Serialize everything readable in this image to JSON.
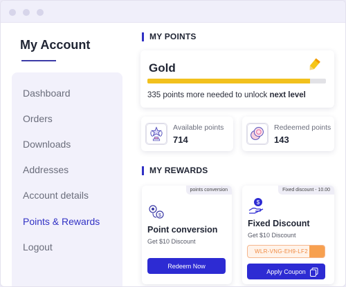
{
  "sidebar": {
    "title": "My Account",
    "items": [
      {
        "label": "Dashboard",
        "active": false
      },
      {
        "label": "Orders",
        "active": false
      },
      {
        "label": "Downloads",
        "active": false
      },
      {
        "label": "Addresses",
        "active": false
      },
      {
        "label": "Account details",
        "active": false
      },
      {
        "label": "Points & Rewards",
        "active": true
      },
      {
        "label": "Logout",
        "active": false
      }
    ]
  },
  "points": {
    "heading": "MY POINTS",
    "level_name": "Gold",
    "progress_fraction": 0.91,
    "note_prefix": "335 points more needed to unlock ",
    "note_bold": "next level",
    "available": {
      "label": "Available points",
      "value": "714",
      "icon": "trophy-icon"
    },
    "redeemed": {
      "label": "Redeemed points",
      "value": "143",
      "icon": "coins-icon"
    }
  },
  "rewards": {
    "heading": "MY REWARDS",
    "cards": [
      {
        "tag": "points conversion",
        "title": "Point conversion",
        "subtitle": "Get $10 Discount",
        "button": "Redeem Now",
        "icon": "conversion-icon"
      },
      {
        "tag": "Fixed discount - 10.00",
        "title": "Fixed Discount",
        "subtitle": "Get $10 Discount",
        "coupon_code": "WLR-VNG-EH9-LF2",
        "button": "Apply Coupon",
        "icon": "hand-coin-icon"
      }
    ]
  },
  "colors": {
    "accent": "#2d2bd3",
    "active_nav": "#3131c4",
    "gold": "#f2c11d",
    "coupon": "#f7a04f"
  }
}
